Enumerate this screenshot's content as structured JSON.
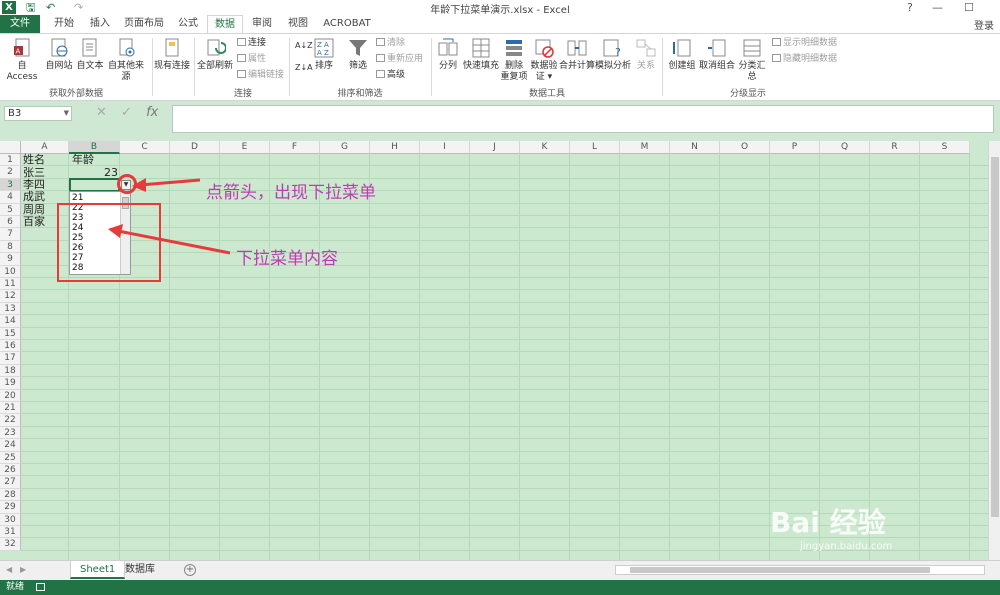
{
  "window": {
    "title": "年龄下拉菜单演示.xlsx - Excel",
    "app_logo": "X",
    "controls": [
      "?",
      "—",
      "☐"
    ],
    "sign_in": "登录"
  },
  "quick_access": {
    "save_icon": "save-icon",
    "undo": "↶",
    "redo": "↷"
  },
  "tabs": [
    {
      "label": "文件",
      "active": false
    },
    {
      "label": "开始",
      "active": false
    },
    {
      "label": "插入",
      "active": false
    },
    {
      "label": "页面布局",
      "active": false
    },
    {
      "label": "公式",
      "active": false
    },
    {
      "label": "数据",
      "active": true
    },
    {
      "label": "审阅",
      "active": false
    },
    {
      "label": "视图",
      "active": false
    },
    {
      "label": "ACROBAT",
      "active": false
    }
  ],
  "ribbon": {
    "groups": {
      "external": "获取外部数据",
      "connections": "连接",
      "sort_filter": "排序和筛选",
      "data_tools": "数据工具",
      "outline": "分级显示"
    },
    "buttons": {
      "access": "自 Access",
      "web": "自网站",
      "text": "自文本",
      "other": "自其他来源",
      "existing": "现有连接",
      "refresh_all": "全部刷新",
      "connections": "连接",
      "properties": "属性",
      "edit_links": "编辑链接",
      "sort": "排序",
      "filter": "筛选",
      "clear": "清除",
      "reapply": "重新应用",
      "advanced": "高级",
      "split": "分列",
      "flash_fill": "快速填充",
      "remove_dup_1": "删除",
      "remove_dup_2": "重复项",
      "validation_1": "数据验",
      "validation_2": "证 ▾",
      "consolidate": "合并计算",
      "whatif": "模拟分析",
      "relations": "关系",
      "group": "创建组",
      "ungroup": "取消组合",
      "subtotal": "分类汇总",
      "show_detail": "显示明细数据",
      "hide_detail": "隐藏明细数据",
      "sort_az": "A↓Z",
      "sort_za": "Z↓A"
    }
  },
  "formula_bar": {
    "name_box": "B3",
    "cancel": "✕",
    "enter": "✓",
    "fx": "fx",
    "value": ""
  },
  "columns": [
    "A",
    "B",
    "C",
    "D",
    "E",
    "F",
    "G",
    "H",
    "I",
    "J",
    "K",
    "L",
    "M",
    "N",
    "O",
    "P",
    "Q",
    "R",
    "S"
  ],
  "rows": [
    "1",
    "2",
    "3",
    "4",
    "5",
    "6",
    "7",
    "8",
    "9",
    "10",
    "11",
    "12",
    "13",
    "14",
    "15",
    "16",
    "17",
    "18",
    "19",
    "20",
    "21",
    "22",
    "23",
    "24",
    "25",
    "26",
    "27",
    "28",
    "29",
    "30",
    "31",
    "32"
  ],
  "cells": {
    "A1": "姓名",
    "B1": "年龄",
    "A2": "张三",
    "B2": "23",
    "A3": "李四",
    "A4": "成武",
    "A5": "周周",
    "A6": "百家"
  },
  "dropdown": {
    "items": [
      "21",
      "22",
      "23",
      "24",
      "25",
      "26",
      "27",
      "28"
    ]
  },
  "annotations": {
    "arrow_label": "点箭头，出现下拉菜单",
    "menu_label": "下拉菜单内容"
  },
  "sheets": [
    {
      "label": "Sheet1",
      "active": true
    },
    {
      "label": "数据库",
      "active": false
    }
  ],
  "status": {
    "ready": "就绪",
    "watermark": "Bai 经验",
    "watermark_url": "jingyan.baidu.com"
  },
  "colors": {
    "accent": "#217346",
    "grid": "#cce8cf",
    "annotation_red": "#e53b3b",
    "annotation_text": "#c03bb3"
  }
}
